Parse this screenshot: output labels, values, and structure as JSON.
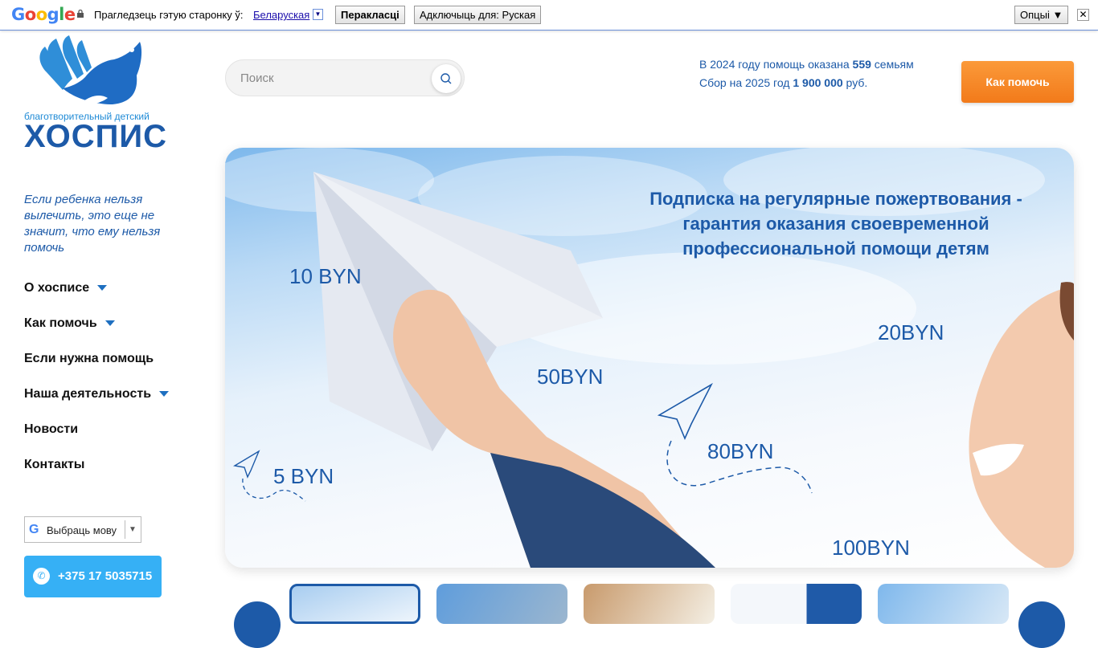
{
  "translate_bar": {
    "logo_text": "Google",
    "prompt": "Прагледзець гэтую старонку ў:",
    "language": "Беларуская",
    "translate_button": "Перакласці",
    "always_button": "Адключыць для: Руская",
    "options_button": "Опцыі ▼",
    "close_symbol": "✕"
  },
  "logo": {
    "small_text": "благотворительный детский",
    "big_text": "ХОСПИС"
  },
  "tagline": "Если ребенка нельзя вылечить, это еще не значит, что ему нельзя помочь",
  "nav": {
    "items": [
      {
        "label": "О хосписе",
        "has_dropdown": true
      },
      {
        "label": "Как помочь",
        "has_dropdown": true
      },
      {
        "label": "Если нужна помощь",
        "has_dropdown": false
      },
      {
        "label": "Наша деятельность",
        "has_dropdown": true
      },
      {
        "label": "Новости",
        "has_dropdown": false
      },
      {
        "label": "Контакты",
        "has_dropdown": false
      }
    ]
  },
  "lang_select": {
    "g": "G",
    "label": "Выбраць мову",
    "arrow": "▼"
  },
  "phone": {
    "number": "+375 17 5035715",
    "icon": "phone-icon",
    "icon_glyph": "✆"
  },
  "search": {
    "placeholder": "Поиск"
  },
  "stats": {
    "line1_pre": "В 2024 году помощь оказана ",
    "line1_num": "559",
    "line1_post": " семьям",
    "line2_pre": "Сбор на 2025 год ",
    "line2_num": "1 900 000",
    "line2_post": " руб."
  },
  "help_button": "Как помочь",
  "banner": {
    "title_lines": [
      "Подписка на регулярные пожертвования -",
      "гарантия оказания своевременной",
      "профессиональной помощи детям"
    ],
    "amounts": [
      "10 BYN",
      "20BYN",
      "50BYN",
      "80BYN",
      "5 BYN",
      "100BYN"
    ]
  },
  "colors": {
    "brand_blue": "#1d5aa8",
    "accent_orange": "#f27a1a",
    "phone_blue": "#36b0f5"
  }
}
